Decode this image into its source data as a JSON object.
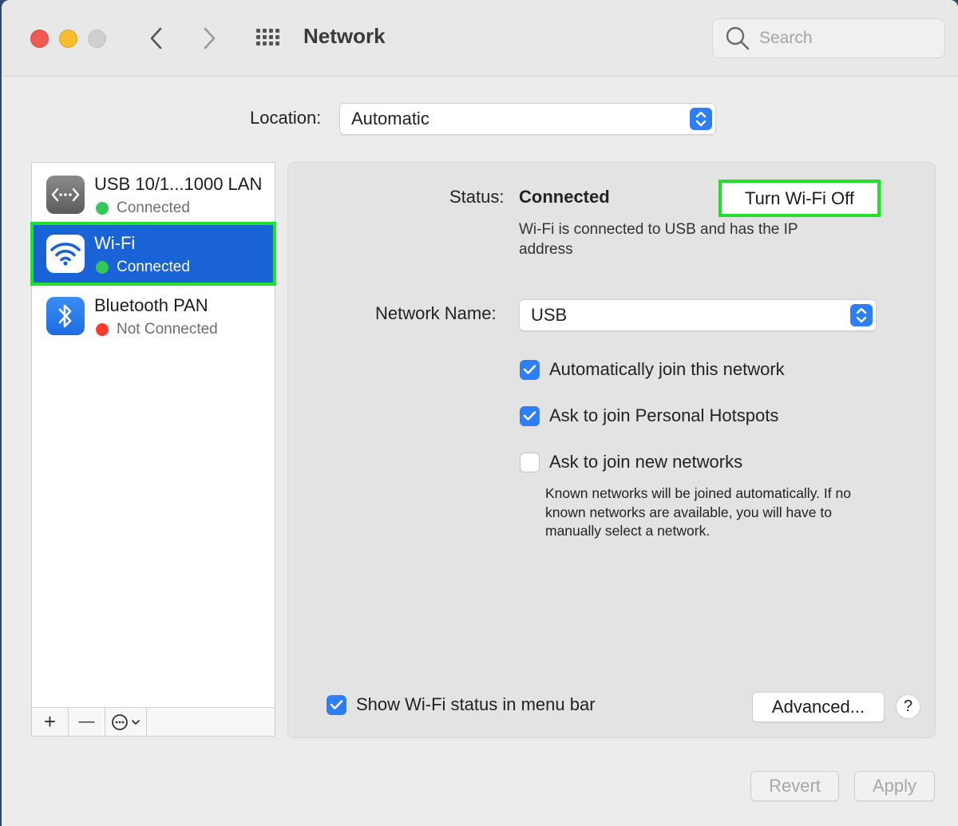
{
  "window": {
    "title": "Network",
    "search_placeholder": "Search"
  },
  "location": {
    "label": "Location:",
    "value": "Automatic"
  },
  "services": [
    {
      "name": "USB 10/1...1000 LAN",
      "status": "Connected",
      "status_color": "#34c759",
      "icon": "ethernet-icon"
    },
    {
      "name": "Wi-Fi",
      "status": "Connected",
      "status_color": "#34c759",
      "icon": "wifi-icon",
      "selected": true
    },
    {
      "name": "Bluetooth PAN",
      "status": "Not Connected",
      "status_color": "#ff3b30",
      "icon": "bluetooth-icon"
    }
  ],
  "sidebar_toolbar": {
    "add_label": "+",
    "remove_label": "—"
  },
  "detail": {
    "status_label": "Status:",
    "status_value": "Connected",
    "turn_off_label": "Turn Wi-Fi Off",
    "status_description": "Wi-Fi is connected to USB and has the IP address",
    "network_name_label": "Network Name:",
    "network_name_value": "USB",
    "auto_join_label": "Automatically join this network",
    "auto_join_checked": true,
    "hotspots_label": "Ask to join Personal Hotspots",
    "hotspots_checked": true,
    "new_networks_label": "Ask to join new networks",
    "new_networks_checked": false,
    "hint": "Known networks will be joined automatically. If no known networks are available, you will have to manually select a network.",
    "show_status_label": "Show Wi-Fi status in menu bar",
    "show_status_checked": true,
    "advanced_label": "Advanced...",
    "help_label": "?"
  },
  "footer": {
    "revert_label": "Revert",
    "apply_label": "Apply"
  },
  "colors": {
    "accent": "#2d7ff9",
    "selection": "#1a63d7",
    "highlight_outline": "#20e02c"
  }
}
